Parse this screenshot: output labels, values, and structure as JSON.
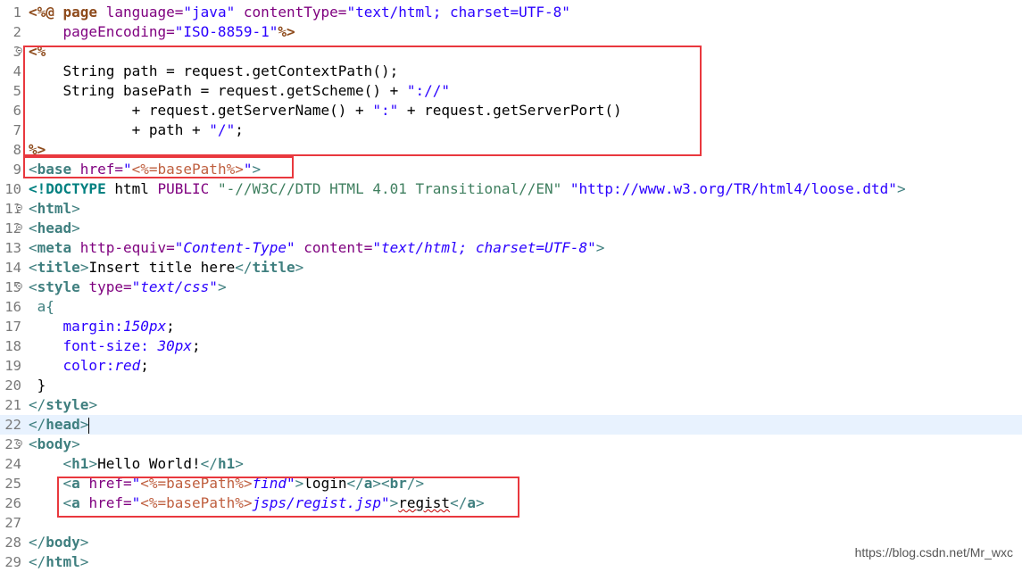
{
  "editor": {
    "line_numbers": [
      "1",
      "2",
      "3",
      "4",
      "5",
      "6",
      "7",
      "8",
      "9",
      "10",
      "11",
      "12",
      "13",
      "14",
      "15",
      "16",
      "17",
      "18",
      "19",
      "20",
      "21",
      "22",
      "23",
      "24",
      "25",
      "26",
      "27",
      "28",
      "29"
    ],
    "lines": {
      "l1": [
        "<%@ ",
        "page ",
        "language=",
        "\"java\"",
        " contentType=",
        "\"text/html; charset=UTF-8\""
      ],
      "l2": [
        "    pageEncoding=",
        "\"ISO-8859-1\"",
        "%>"
      ],
      "l3": [
        "<%"
      ],
      "l4": [
        "    String path = request.getContextPath();"
      ],
      "l5": [
        "    String basePath = request.getScheme() + ",
        "\"://\""
      ],
      "l6": [
        "            + request.getServerName() + ",
        "\":\"",
        " + request.getServerPort()"
      ],
      "l7": [
        "            + path + ",
        "\"/\"",
        ";"
      ],
      "l8": [
        "%>"
      ],
      "l9": [
        "<",
        "base",
        " href=",
        "\"",
        "<%=basePath%>",
        "\"",
        ">"
      ],
      "l10": [
        "<!DOCTYPE ",
        "html ",
        "PUBLIC ",
        "\"-//W3C//DTD HTML 4.01 Transitional//EN\"",
        " ",
        "\"http://www.w3.org/TR/html4/loose.dtd\"",
        ">"
      ],
      "l11": [
        "<",
        "html",
        ">"
      ],
      "l12": [
        "<",
        "head",
        ">"
      ],
      "l13": [
        "<",
        "meta",
        " http-equiv=",
        "\"Content-Type\"",
        " content=",
        "\"text/html; charset=UTF-8\"",
        ">"
      ],
      "l14": [
        "<",
        "title",
        ">",
        "Insert title here",
        "</",
        "title",
        ">"
      ],
      "l15": [
        "<",
        "style",
        " type=",
        "\"text/css\"",
        ">"
      ],
      "l16": [
        " a{"
      ],
      "l17": [
        "    margin:",
        "150px",
        ";"
      ],
      "l18": [
        "    font-size: ",
        "30px",
        ";"
      ],
      "l19": [
        "    color:",
        "red",
        ";"
      ],
      "l20": [
        " }"
      ],
      "l21": [
        "</",
        "style",
        ">"
      ],
      "l22": [
        "</",
        "head",
        ">"
      ],
      "l23": [
        "<",
        "body",
        ">"
      ],
      "l24": [
        "    <",
        "h1",
        ">",
        "Hello World!",
        "</",
        "h1",
        ">"
      ],
      "l25": [
        "    <",
        "a",
        " href=",
        "\"",
        "<%=basePath%>",
        "find",
        "\"",
        ">",
        "login",
        "</",
        "a",
        "><",
        "br",
        "/>"
      ],
      "l26": [
        "    <",
        "a",
        " href=",
        "\"",
        "<%=basePath%>",
        "jsps/regist.jsp",
        "\"",
        ">",
        "regist",
        "</",
        "a",
        ">"
      ],
      "l27": [
        ""
      ],
      "l28": [
        "</",
        "body",
        ">"
      ],
      "l29": [
        "</",
        "html",
        ">"
      ]
    }
  },
  "watermark": "https://blog.csdn.net/Mr_wxc",
  "colors": {
    "highlight_box": "#e9383e",
    "tag": "#3f7f7f",
    "string": "#2a00ff",
    "attribute": "#7f007f",
    "jsp_directive": "#8e4b1c",
    "current_line": "#e8f2fe"
  }
}
